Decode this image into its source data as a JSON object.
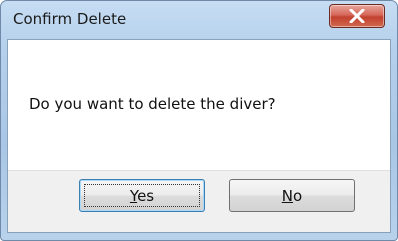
{
  "dialog": {
    "title": "Confirm Delete",
    "close_symbol": "×",
    "close_icon": "close-icon",
    "message": "Do you want to delete the diver?",
    "buttons": {
      "yes": {
        "mnemonic": "Y",
        "rest": "es",
        "label": "Yes"
      },
      "no": {
        "mnemonic": "N",
        "rest": "o",
        "label": "No"
      }
    },
    "focused_button": "Yes"
  },
  "colors": {
    "close_button": "#c2402f",
    "frame": "#b5d0ec",
    "client_background": "#f0f0f0",
    "message_background": "#ffffff"
  }
}
